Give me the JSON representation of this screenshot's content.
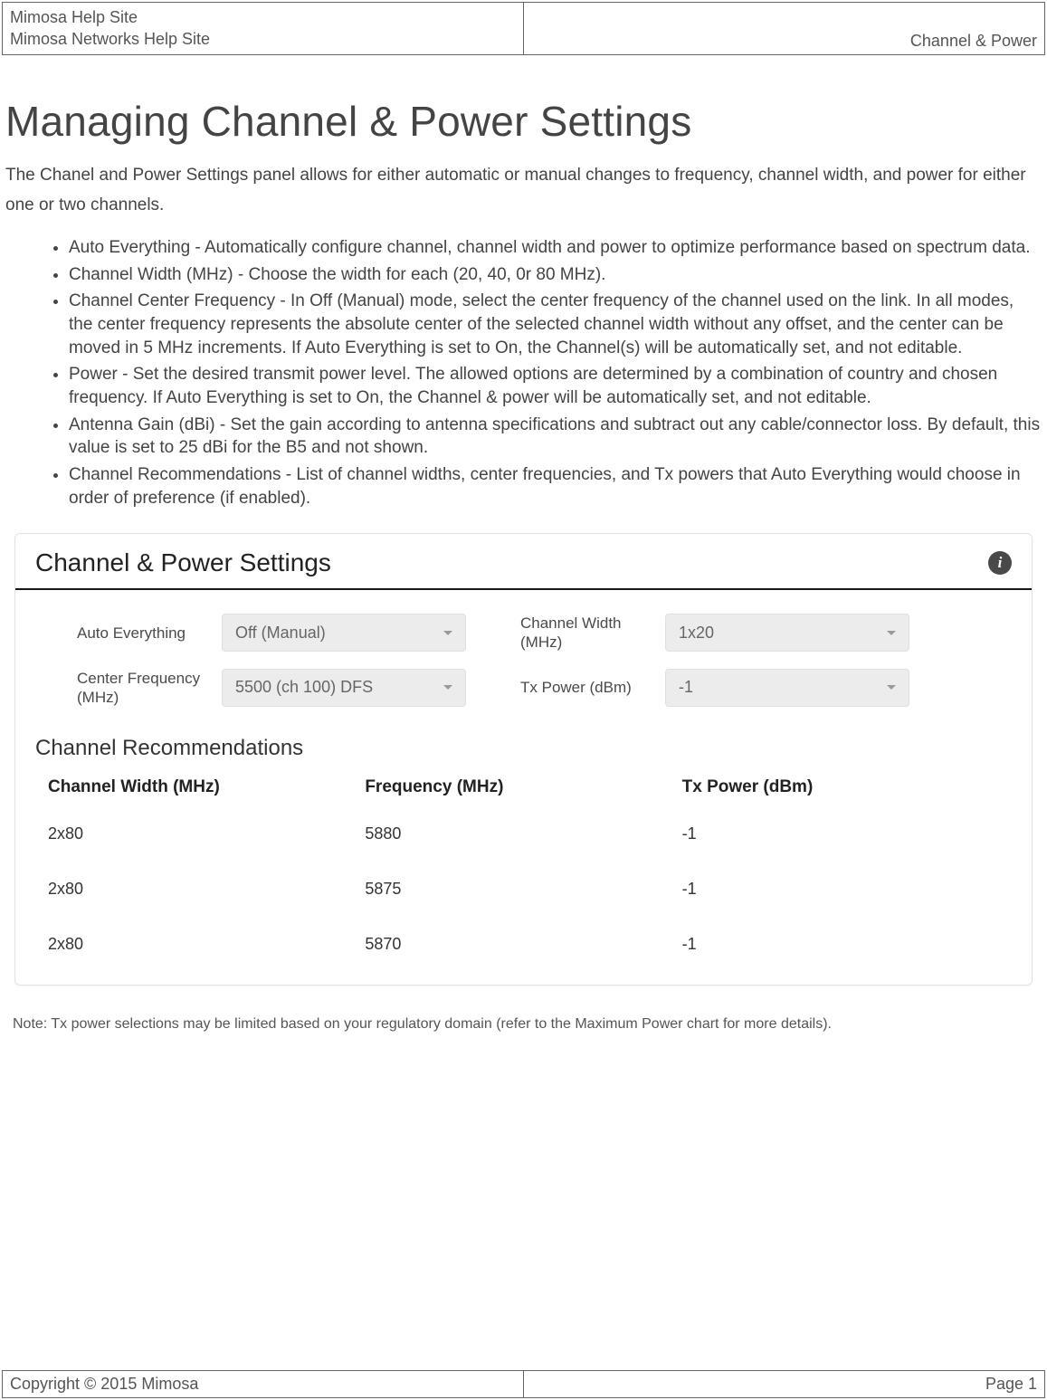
{
  "header": {
    "line1": "Mimosa Help Site",
    "line2": "Mimosa Networks Help Site",
    "right": "Channel & Power"
  },
  "main": {
    "title": "Managing Channel & Power Settings",
    "intro": "The Chanel and Power Settings panel allows for either automatic or manual changes to frequency, channel width, and power for either one or two channels.",
    "bullets": [
      "Auto Everything - Automatically configure channel, channel width and power to optimize performance based on spectrum data.",
      "Channel Width (MHz) - Choose the width for each (20, 40, 0r 80 MHz).",
      "Channel Center Frequency - In Off (Manual) mode, select the center frequency of the channel used on the link. In all modes, the center frequency represents the absolute center of the selected channel width without any offset, and the center can be moved in 5 MHz increments. If Auto Everything is set to On, the Channel(s) will be automatically set, and not editable.",
      "Power - Set the desired transmit power level. The allowed options are determined by a combination of country and chosen frequency. If Auto Everything is set to On, the Channel & power will be automatically set, and not editable.",
      "Antenna Gain (dBi) - Set the gain according to antenna specifications and subtract out any cable/connector loss.  By default, this value is set to 25 dBi for the B5 and not shown.",
      "Channel Recommendations - List of channel widths, center frequencies, and Tx powers that Auto Everything would choose in order of preference (if enabled)."
    ]
  },
  "panel": {
    "title": "Channel & Power Settings",
    "info_icon": "info-icon",
    "fields": {
      "auto_everything": {
        "label": "Auto Everything",
        "value": "Off (Manual)"
      },
      "channel_width": {
        "label": "Channel Width (MHz)",
        "value": "1x20"
      },
      "center_freq": {
        "label": "Center Frequency (MHz)",
        "value": "5500 (ch 100) DFS"
      },
      "tx_power": {
        "label": "Tx Power (dBm)",
        "value": "-1"
      }
    },
    "recommendations": {
      "heading": "Channel Recommendations",
      "columns": [
        "Channel Width (MHz)",
        "Frequency (MHz)",
        "Tx Power (dBm)"
      ],
      "rows": [
        {
          "width": "2x80",
          "freq": "5880",
          "tx": "-1"
        },
        {
          "width": "2x80",
          "freq": "5875",
          "tx": "-1"
        },
        {
          "width": "2x80",
          "freq": "5870",
          "tx": "-1"
        }
      ]
    }
  },
  "note": "Note: Tx power selections may be limited based on your regulatory domain (refer to the Maximum Power chart for more details).",
  "footer": {
    "left": "Copyright © 2015 Mimosa",
    "right": "Page 1"
  }
}
